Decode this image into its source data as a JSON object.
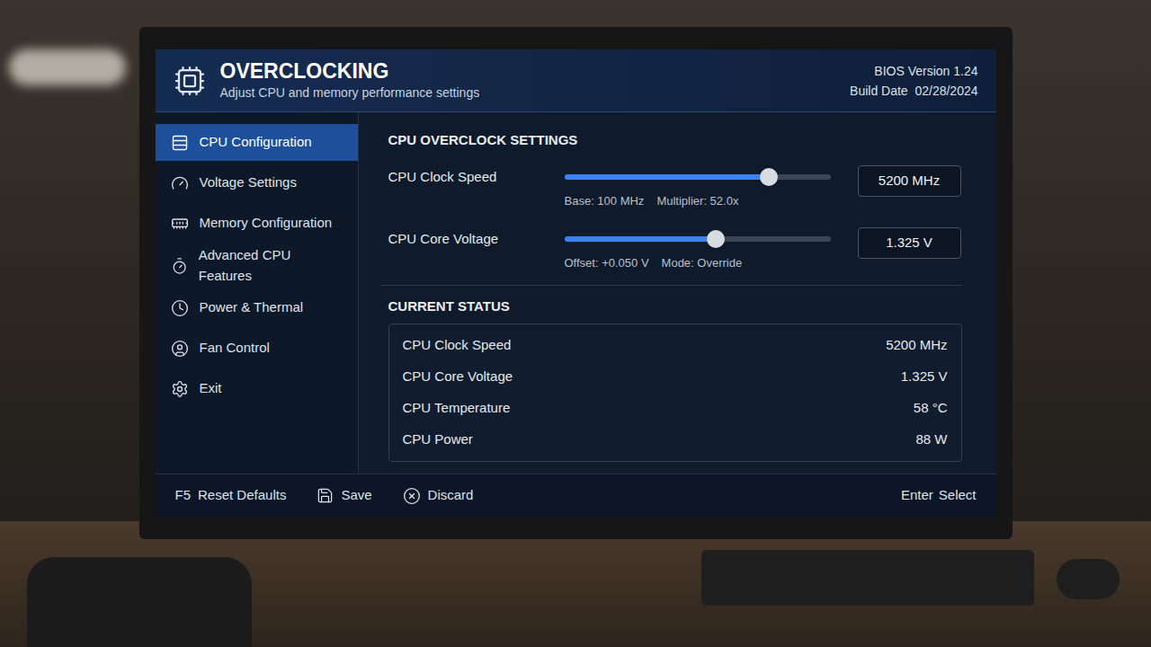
{
  "header": {
    "title": "OVERCLOCKING",
    "subtitle": "Adjust CPU and memory performance settings",
    "version": "BIOS Version 1.24",
    "build": "Build Date  02/28/2024"
  },
  "sidebar": {
    "items": [
      {
        "label": "CPU Configuration",
        "selected": true
      },
      {
        "label": "Voltage Settings",
        "selected": false
      },
      {
        "label": "Memory Configuration",
        "selected": false
      },
      {
        "label": "Advanced CPU Features",
        "selected": false
      },
      {
        "label": "Power & Thermal",
        "selected": false
      },
      {
        "label": "Fan Control",
        "selected": false
      },
      {
        "label": "Exit",
        "selected": false
      }
    ]
  },
  "settings": {
    "title": "CPU OVERCLOCK SETTINGS",
    "sliders": [
      {
        "label": "CPU Clock Speed",
        "level": 0.77,
        "value": "5200 MHz",
        "notes": [
          "Base: 100 MHz",
          "Multiplier: 52.0x"
        ]
      },
      {
        "label": "CPU Core Voltage",
        "level": 0.57,
        "value": "1.325 V",
        "notes": [
          "Offset: +0.050 V",
          "Mode: Override"
        ]
      }
    ]
  },
  "status": {
    "title": "CURRENT STATUS",
    "rows": [
      {
        "label": "CPU Clock Speed",
        "value": "5200 MHz"
      },
      {
        "label": "CPU Core Voltage",
        "value": "1.325 V"
      },
      {
        "label": "CPU Temperature",
        "value": "58 °C"
      },
      {
        "label": "CPU Power",
        "value": "88 W"
      }
    ]
  },
  "footer": {
    "reset_key": "F5",
    "reset_label": "Reset Defaults",
    "save": "Save",
    "discard": "Discard",
    "enter_key": "Enter",
    "enter_label": "Select"
  }
}
